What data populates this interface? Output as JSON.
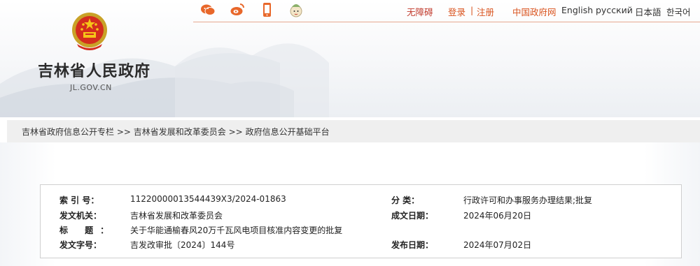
{
  "topbar": {
    "social_icons": [
      "wechat-icon",
      "weibo-icon",
      "mobile-icon",
      "mascot-icon"
    ],
    "accessibility_label": "无障碍",
    "login_label": "登录",
    "separator": "|",
    "register_label": "注册",
    "china_gov_label": "中国政府网",
    "languages": [
      "English",
      "русский",
      "日本語",
      "한국어"
    ],
    "colors": {
      "accent": "#d9531e",
      "accessible": "#c0392b"
    }
  },
  "site": {
    "title": "吉林省人民政府",
    "domain": "JL.GOV.CN"
  },
  "breadcrumb": {
    "items": [
      "吉林省政府信息公开专栏",
      "吉林省发展和改革委员会",
      "政府信息公开基础平台"
    ],
    "separator": ">>"
  },
  "info": {
    "index_label": "索 引 号：",
    "index_value": "11220000013544439X3/2024-01863",
    "category_label": "分 类：",
    "category_value": "行政许可和办事服务办理结果;批复",
    "issuer_label": "发文机关：",
    "issuer_value": "吉林省发展和改革委员会",
    "date_label": "成文日期：",
    "date_value": "2024年06月20日",
    "title_label": "标 题：",
    "title_value": "关于华能通榆春风20万千瓦风电项目核准内容变更的批复",
    "doc_no_label": "发文字号：",
    "doc_no_value": "吉发改审批〔2024〕144号",
    "publish_label": "发布日期：",
    "publish_value": "2024年07月02日"
  }
}
